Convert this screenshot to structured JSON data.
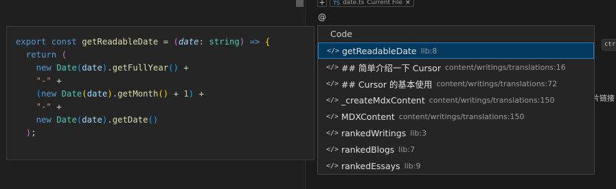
{
  "context_bar": {
    "plus_label": "+",
    "chip_file": "date.ts",
    "chip_note": "Current File",
    "chip_close": "×"
  },
  "composer": {
    "at_sign": "@"
  },
  "side": {
    "hint_text": "t",
    "ctrl_chip": "ctrl-",
    "cjk_text": "片链接"
  },
  "code_preview": {
    "lines": [
      "export const getReadableDate = (date: string) => {",
      "  return (",
      "    new Date(date).getFullYear() +",
      "    \"-\" +",
      "    (new Date(date).getMonth() + 1) +",
      "    \"-\" +",
      "    new Date(date).getDate()",
      "  );"
    ]
  },
  "suggestions": {
    "header": "Code",
    "icon": "code-brackets-icon",
    "items": [
      {
        "label": "getReadableDate",
        "detail": "lib:8",
        "selected": true
      },
      {
        "label": "## 简单介绍一下 Cursor",
        "detail": "content/writings/translations:16"
      },
      {
        "label": "## Cursor 的基本使用",
        "detail": "content/writings/translations:72"
      },
      {
        "label": "_createMdxContent",
        "detail": "content/writings/translations:150"
      },
      {
        "label": "MDXContent",
        "detail": "content/writings/translations:150"
      },
      {
        "label": "rankedWritings",
        "detail": "lib:3"
      },
      {
        "label": "rankedBlogs",
        "detail": "lib:7"
      },
      {
        "label": "rankedEssays",
        "detail": "lib:9"
      }
    ]
  },
  "colors": {
    "selected_bg": "#04395e",
    "selected_border": "#2b79c2",
    "popup_bg": "#252526"
  }
}
